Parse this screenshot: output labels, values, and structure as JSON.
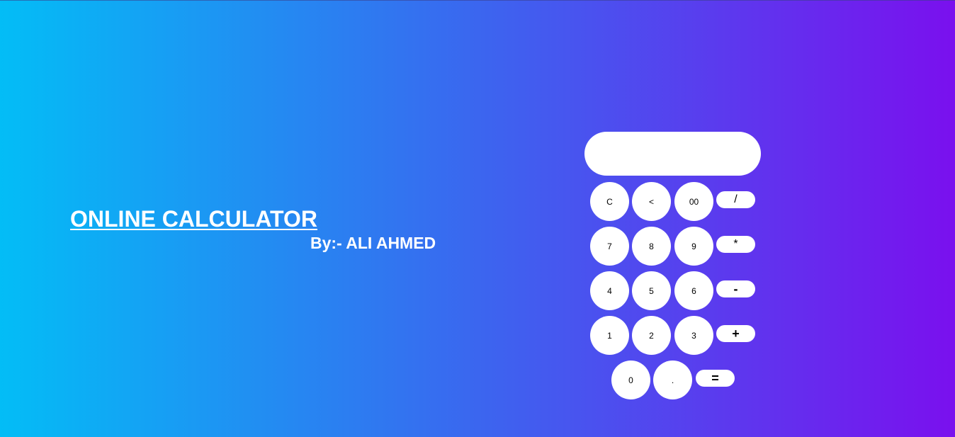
{
  "header": {
    "title": "ONLINE CALCULATOR",
    "byline": "By:- ALI AHMED"
  },
  "calculator": {
    "display_value": "",
    "keys": {
      "clear": "C",
      "back": "<",
      "double_zero": "00",
      "divide": "/",
      "seven": "7",
      "eight": "8",
      "nine": "9",
      "multiply": "*",
      "four": "4",
      "five": "5",
      "six": "6",
      "subtract": "-",
      "one": "1",
      "two": "2",
      "three": "3",
      "add": "+",
      "zero": "0",
      "decimal": ".",
      "equals": "="
    }
  },
  "colors": {
    "gradient_start": "#03bdf6",
    "gradient_mid": "#3b66ef",
    "gradient_end": "#7a10ee",
    "button_bg": "#ffffff",
    "text": "#ffffff"
  }
}
